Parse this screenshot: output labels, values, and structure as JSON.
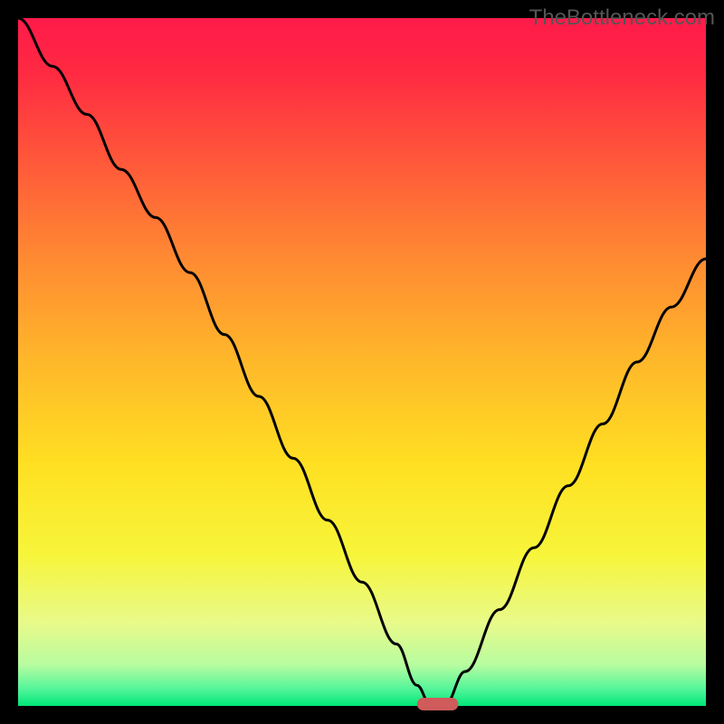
{
  "watermark": "TheBottleneck.com",
  "chart_data": {
    "type": "line",
    "title": "",
    "xlabel": "",
    "ylabel": "",
    "xlim": [
      0,
      100
    ],
    "ylim": [
      0,
      100
    ],
    "x": [
      0,
      5,
      10,
      15,
      20,
      25,
      30,
      35,
      40,
      45,
      50,
      55,
      58,
      60,
      62,
      65,
      70,
      75,
      80,
      85,
      90,
      95,
      100
    ],
    "values": [
      100,
      93,
      86,
      78,
      71,
      63,
      54,
      45,
      36,
      27,
      18,
      9,
      3,
      0,
      0,
      5,
      14,
      23,
      32,
      41,
      50,
      58,
      65
    ],
    "minimum_marker": {
      "x": 61,
      "width": 6,
      "color": "#cf5b5b"
    },
    "grid": false,
    "legend": false,
    "annotations": []
  },
  "colors": {
    "frame": "#000000",
    "line": "#000000",
    "gradient_stops": [
      {
        "offset": 0.0,
        "color": "#ff1a4a"
      },
      {
        "offset": 0.08,
        "color": "#ff2a42"
      },
      {
        "offset": 0.2,
        "color": "#ff553a"
      },
      {
        "offset": 0.35,
        "color": "#ff8a32"
      },
      {
        "offset": 0.5,
        "color": "#ffb82a"
      },
      {
        "offset": 0.65,
        "color": "#ffe022"
      },
      {
        "offset": 0.78,
        "color": "#f7f53a"
      },
      {
        "offset": 0.88,
        "color": "#e8fa8a"
      },
      {
        "offset": 0.94,
        "color": "#b8fca0"
      },
      {
        "offset": 0.975,
        "color": "#55f59a"
      },
      {
        "offset": 1.0,
        "color": "#00e878"
      }
    ]
  },
  "layout": {
    "outer": 800,
    "frame": 20,
    "plot": 760
  }
}
